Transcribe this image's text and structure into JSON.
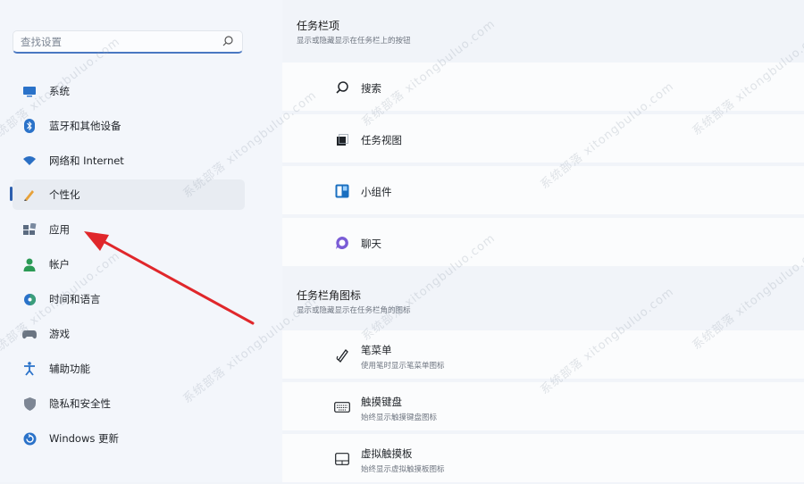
{
  "search": {
    "placeholder": "查找设置"
  },
  "sidebar": {
    "items": [
      {
        "label": "系统",
        "icon": "monitor-icon"
      },
      {
        "label": "蓝牙和其他设备",
        "icon": "bluetooth-icon"
      },
      {
        "label": "网络和 Internet",
        "icon": "wifi-icon"
      },
      {
        "label": "个性化",
        "icon": "pencil-icon",
        "active": true
      },
      {
        "label": "应用",
        "icon": "apps-icon"
      },
      {
        "label": "帐户",
        "icon": "person-icon"
      },
      {
        "label": "时间和语言",
        "icon": "globe-clock-icon"
      },
      {
        "label": "游戏",
        "icon": "gamepad-icon"
      },
      {
        "label": "辅助功能",
        "icon": "accessibility-icon"
      },
      {
        "label": "隐私和安全性",
        "icon": "shield-icon"
      },
      {
        "label": "Windows 更新",
        "icon": "update-icon"
      }
    ]
  },
  "main": {
    "taskbar_items": {
      "title": "任务栏项",
      "subtitle": "显示或隐藏显示在任务栏上的按钮",
      "items": [
        {
          "label": "搜索",
          "icon": "search-icon"
        },
        {
          "label": "任务视图",
          "icon": "task-view-icon"
        },
        {
          "label": "小组件",
          "icon": "widgets-icon"
        },
        {
          "label": "聊天",
          "icon": "chat-icon"
        }
      ]
    },
    "corner_icons": {
      "title": "任务栏角图标",
      "subtitle": "显示或隐藏显示在任务栏角的图标",
      "items": [
        {
          "label": "笔菜单",
          "description": "使用笔时显示笔菜单图标",
          "icon": "pen-icon"
        },
        {
          "label": "触摸键盘",
          "description": "始终显示触摸键盘图标",
          "icon": "keyboard-icon"
        },
        {
          "label": "虚拟触摸板",
          "description": "始终显示虚拟触摸板图标",
          "icon": "touchpad-icon"
        }
      ]
    }
  },
  "watermark": "系统部落 xitongbuluo.com",
  "colors": {
    "accent": "#2d5fae",
    "arrow": "#e0272b"
  }
}
